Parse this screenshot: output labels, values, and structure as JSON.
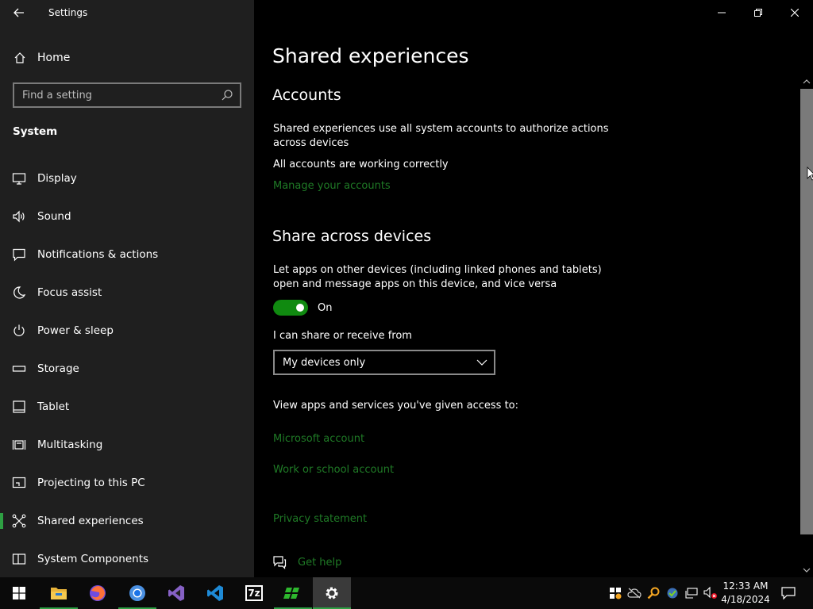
{
  "window": {
    "title": "Settings"
  },
  "sidebar": {
    "home_label": "Home",
    "search_placeholder": "Find a setting",
    "section_title": "System",
    "items": [
      {
        "label": "Display",
        "icon": "display-icon"
      },
      {
        "label": "Sound",
        "icon": "speaker-icon"
      },
      {
        "label": "Notifications & actions",
        "icon": "notification-icon"
      },
      {
        "label": "Focus assist",
        "icon": "moon-icon"
      },
      {
        "label": "Power & sleep",
        "icon": "power-icon"
      },
      {
        "label": "Storage",
        "icon": "storage-icon"
      },
      {
        "label": "Tablet",
        "icon": "tablet-icon"
      },
      {
        "label": "Multitasking",
        "icon": "multitasking-icon"
      },
      {
        "label": "Projecting to this PC",
        "icon": "projecting-icon"
      },
      {
        "label": "Shared experiences",
        "icon": "shared-experiences-icon",
        "active": true
      },
      {
        "label": "System Components",
        "icon": "system-components-icon"
      }
    ]
  },
  "main": {
    "title": "Shared experiences",
    "accounts": {
      "heading": "Accounts",
      "description": "Shared experiences use all system accounts to authorize actions across devices",
      "status": "All accounts are working correctly",
      "manage_link": "Manage your accounts"
    },
    "share": {
      "heading": "Share across devices",
      "description": "Let apps on other devices (including linked phones and tablets) open and message apps on this device, and vice versa",
      "toggle_state": "On",
      "dropdown_label": "I can share or receive from",
      "dropdown_value": "My devices only",
      "access_label": "View apps and services you've given access to:",
      "microsoft_link": "Microsoft account",
      "work_link": "Work or school account"
    },
    "privacy_link": "Privacy statement",
    "help_link": "Get help"
  },
  "taskbar": {
    "apps": [
      {
        "name": "start-button",
        "label": "Start"
      },
      {
        "name": "file-explorer",
        "label": "File Explorer"
      },
      {
        "name": "firefox",
        "label": "Firefox"
      },
      {
        "name": "chrome",
        "label": "Chrome"
      },
      {
        "name": "visual-studio",
        "label": "Visual Studio"
      },
      {
        "name": "vscode",
        "label": "VS Code"
      },
      {
        "name": "7zip",
        "label": "7z"
      },
      {
        "name": "green-app",
        "label": "App"
      },
      {
        "name": "settings",
        "label": "Settings",
        "active": true
      }
    ],
    "clock_time": "12:33 AM",
    "clock_date": "4/18/2024"
  },
  "colors": {
    "accent": "#2ea043",
    "link": "#1f7a26",
    "toggle_on": "#108a10",
    "sidebar_bg": "#1f1f1f",
    "main_bg": "#000000"
  }
}
